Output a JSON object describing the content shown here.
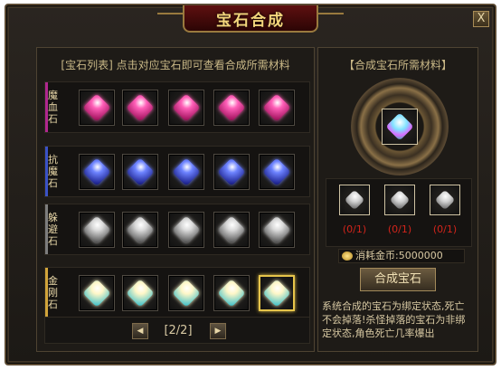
{
  "window": {
    "title": "宝石合成",
    "close_label": "X"
  },
  "gem_list": {
    "header": "[宝石列表] 点击对应宝石即可查看合成所需材料",
    "rows": [
      {
        "label": [
          "魔",
          "血",
          "石"
        ],
        "accent": "#b0278e",
        "gem_color": [
          "#ff5fb8",
          "#a0115c"
        ],
        "gem_icon": "blood-stone-gem-icon"
      },
      {
        "label": [
          "抗",
          "魔",
          "石"
        ],
        "accent": "#3a52c6",
        "gem_color": [
          "#6d83ff",
          "#1a1f8a"
        ],
        "gem_icon": "anti-magic-stone-gem-icon"
      },
      {
        "label": [
          "躲",
          "避",
          "石"
        ],
        "accent": "#7d7d7d",
        "gem_color": [
          "#d9d9d9",
          "#5a5a5a"
        ],
        "gem_icon": "evasion-stone-gem-icon"
      },
      {
        "label": [
          "金",
          "刚",
          "石"
        ],
        "accent": "#d1a43a",
        "gem_color": [
          "#fff7c8",
          "#49c3c9"
        ],
        "gem_icon": "diamond-stone-gem-icon"
      }
    ],
    "selected": {
      "row": 3,
      "col": 4
    }
  },
  "pager": {
    "text": "[2/2]",
    "prev_icon": "arrow-left-icon",
    "next_icon": "arrow-right-icon"
  },
  "materials": {
    "header": "【合成宝石所需材料】",
    "result_icon": "diamond-stone-gem-icon",
    "items": [
      {
        "count": "(0/1)",
        "icon": "silver-gem-icon"
      },
      {
        "count": "(0/1)",
        "icon": "silver-gem-icon"
      },
      {
        "count": "(0/1)",
        "icon": "silver-gem-icon"
      }
    ],
    "cost": "消耗金币:5000000",
    "compose_label": "合成宝石",
    "note": "系统合成的宝石为绑定状态,死亡不会掉落!杀怪掉落的宝石为非绑定状态,角色死亡几率爆出"
  },
  "colors": {
    "title": "#f3d67c",
    "count_red": "#d2241b",
    "gold_border": "#e6c44a"
  }
}
